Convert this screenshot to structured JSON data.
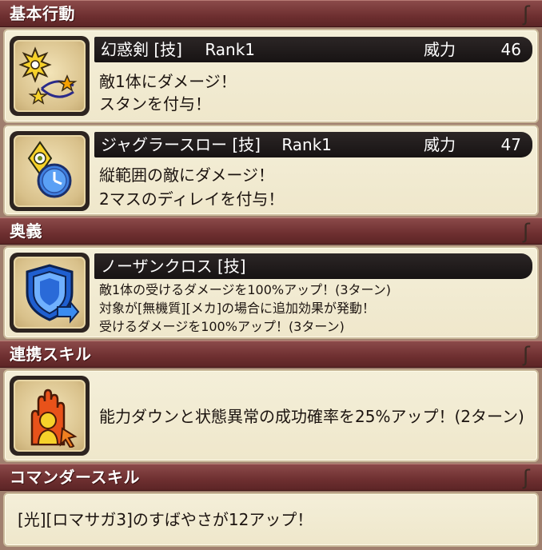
{
  "sections": {
    "basic": "基本行動",
    "ougi": "奥義",
    "renkei": "連携スキル",
    "commander": "コマンダースキル"
  },
  "curl_glyph": "ʃ",
  "skill1": {
    "name": "幻惑剣 [技]",
    "rank": "Rank1",
    "power_label": "威力",
    "power": "46",
    "desc1": "敵1体にダメージ！",
    "desc2": "スタンを付与！",
    "icon": "stars-stun-icon"
  },
  "skill2": {
    "name": "ジャグラースロー [技]",
    "rank": "Rank1",
    "power_label": "威力",
    "power": "47",
    "desc1": "縦範囲の敵にダメージ！",
    "desc2": "2マスのディレイを付与！",
    "icon": "clock-delay-icon"
  },
  "ougi": {
    "name": "ノーザンクロス [技]",
    "desc1": "敵1体の受けるダメージを100%アップ！(3ターン)",
    "desc2": "対象が[無機質][メカ]の場合に追加効果が発動！",
    "desc3": "受けるダメージを100%アップ！(3ターン)",
    "icon": "shield-down-icon"
  },
  "renkei": {
    "desc": "能力ダウンと状態異常の成功確率を25%アップ！(2ターン)",
    "icon": "hand-up-icon"
  },
  "commander": {
    "desc": "[光][ロマサガ3]のすばやさが12アップ！"
  },
  "colors": {
    "header": "#6e2f30",
    "card": "#f2ecd4",
    "title_bar": "#1f1a1a"
  }
}
